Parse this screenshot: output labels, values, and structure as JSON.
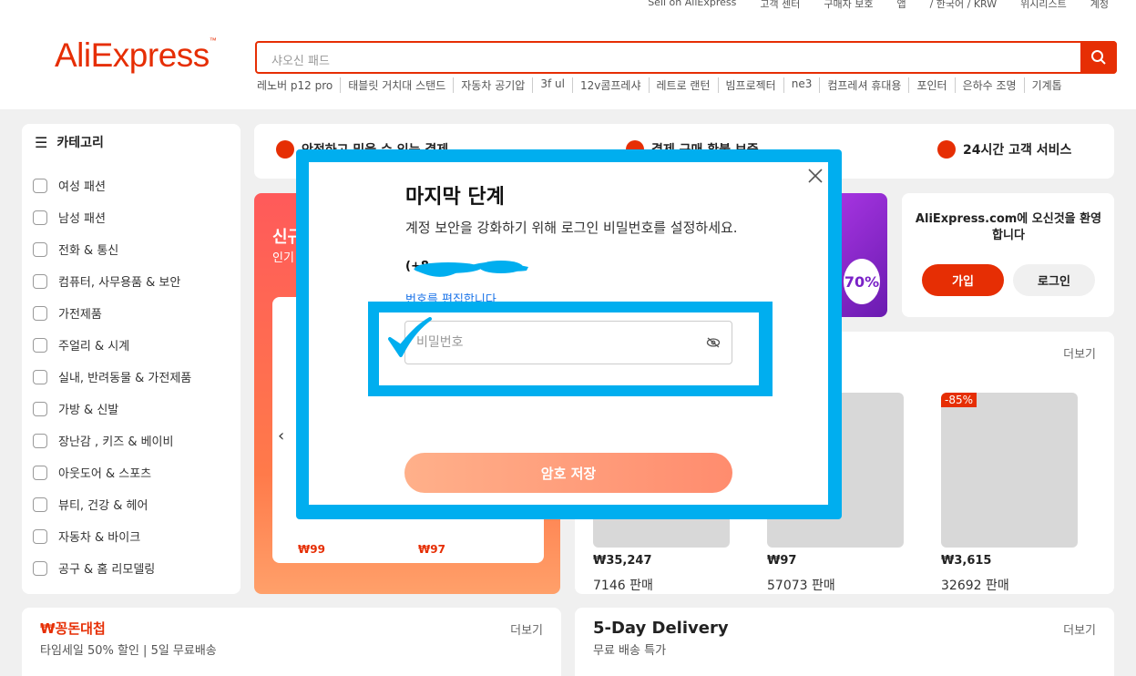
{
  "topbar": {
    "links": [
      "Sell on AliExpress",
      "고객 센터",
      "구매자 보호",
      "앱",
      "/ 한국어 / KRW",
      "위시리스트",
      "계정"
    ]
  },
  "header": {
    "logo": "AliExpress",
    "search_placeholder": "샤오신 패드",
    "hot_searches": [
      "레노버 p12 pro",
      "태블릿 거치대 스탠드",
      "자동차 공기압",
      "3f ul",
      "12v콤프레샤",
      "레트로 랜턴",
      "빔프로젝터",
      "ne3",
      "컴프레셔 휴대용",
      "포인터",
      "은하수 조명",
      "기계톱"
    ]
  },
  "categories": {
    "title": "카테고리",
    "items": [
      "여성 패션",
      "남성 패션",
      "전화 & 통신",
      "컴퓨터, 사무용품 & 보안",
      "가전제품",
      "주얼리 & 시계",
      "실내, 반려동물 & 가전제품",
      "가방 & 신발",
      "장난감 , 키즈 & 베이비",
      "아웃도어 & 스포츠",
      "뷰티, 건강 & 헤어",
      "자동차 & 바이크",
      "공구 & 홈 리모델링"
    ]
  },
  "promo": {
    "item1": "안전하고 믿을 수 있는 결제",
    "item2": "결제 구매 환불 보증",
    "item3": "24시간 고객 서비스"
  },
  "sale": {
    "title": "신규",
    "subtitle": "인기",
    "price1": "₩99",
    "price2": "₩97"
  },
  "banner": {
    "badge": "70%"
  },
  "welcome": {
    "message": "AliExpress.com에 오신것을 환영합니다",
    "join": "가입",
    "login": "로그인"
  },
  "deals": {
    "more": "더보기",
    "products": [
      {
        "price": "₩35,247",
        "sold": "7146 판매",
        "badge": ""
      },
      {
        "price": "₩97",
        "sold": "57073 판매",
        "badge": ""
      },
      {
        "price": "₩3,615",
        "sold": "32692 판매",
        "badge": "-85%"
      }
    ]
  },
  "bottom_left": {
    "title": "₩꽁돈대첩",
    "subtitle": "타임세일 50% 할인 | 5일 무료배송",
    "more": "더보기"
  },
  "bottom_right": {
    "title": "5-Day Delivery",
    "subtitle": "무료 배송 특가",
    "more": "더보기"
  },
  "modal": {
    "title": "마지막 단계",
    "description": "계정 보안을 강화하기 위해 로그인 비밀번호를 설정하세요.",
    "phone_prefix": "(+8",
    "edit_link": "번호를 편집합니다",
    "password_placeholder": "비밀번호",
    "save_button": "암호 저장"
  },
  "colors": {
    "brand": "#e62e04",
    "highlight": "#00aeef"
  }
}
